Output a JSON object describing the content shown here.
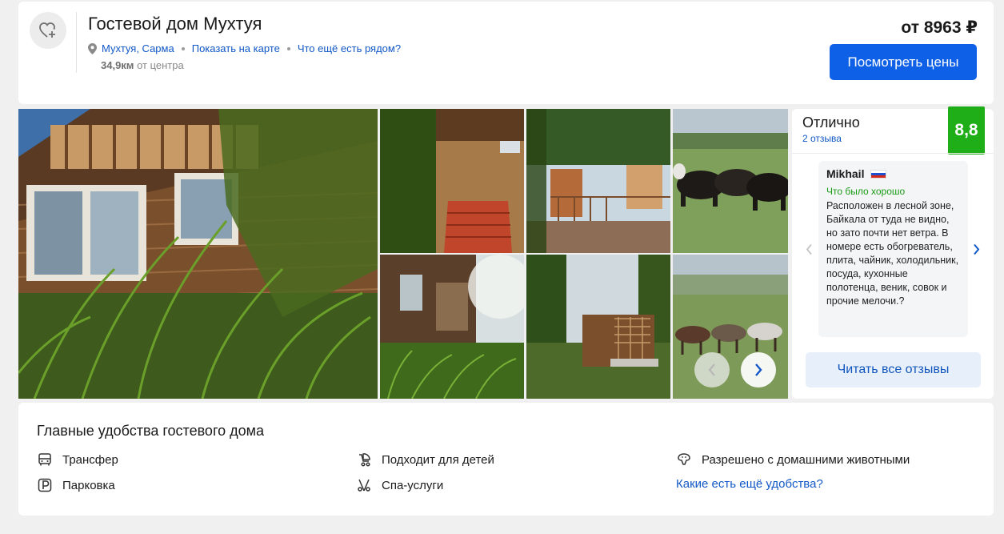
{
  "header": {
    "title": "Гостевой дом Мухтуя",
    "location": "Мухтуя, Сарма",
    "show_on_map": "Показать на карте",
    "whats_nearby": "Что ещё есть рядом?",
    "distance_value": "34,9км",
    "distance_suffix": "от центра",
    "price_prefix": "от",
    "price_value": "8963 ₽",
    "view_prices_label": "Посмотреть цены",
    "icons": {
      "favorite": "heart-plus-icon",
      "location": "map-pin-icon"
    }
  },
  "gallery": {
    "photos": [
      "wooden-house-with-grass",
      "red-porch-stairs",
      "wooden-gazebo-in-forest",
      "yaks-on-pasture",
      "house-corner-in-sunlight",
      "forest-gazebo",
      "horses-on-pasture"
    ],
    "prev_icon": "chevron-left-icon",
    "next_icon": "chevron-right-icon"
  },
  "rating": {
    "label": "Отлично",
    "reviews_count": "2 отзыва",
    "score": "8,8",
    "score_color": "#1fae18"
  },
  "review": {
    "author": "Mikhail",
    "flag": "russia-flag-icon",
    "good_label": "Что было хорошо",
    "text": "Расположен в лесной зоне, Байкала от туда не видно, но зато почти нет ветра. В номере есть обогреватель, плита, чайник, холодильник, посуда, кухонные полотенца, веник, совок и прочие мелочи.?"
  },
  "read_all_label": "Читать все отзывы",
  "amenities": {
    "title": "Главные удобства гостевого дома",
    "items": [
      {
        "label": "Трансфер",
        "icon": "bus-icon"
      },
      {
        "label": "Подходит для детей",
        "icon": "baby-stroller-icon"
      },
      {
        "label": "Разрешено с домашними животными",
        "icon": "pet-icon"
      },
      {
        "label": "Парковка",
        "icon": "parking-icon"
      },
      {
        "label": "Спа-услуги",
        "icon": "spa-icon"
      }
    ],
    "more_link": "Какие есть ещё удобства?"
  },
  "colors": {
    "accent": "#0e60e6",
    "link": "#1158c6",
    "score_green": "#1fae18",
    "good_green": "#1b9b15"
  }
}
